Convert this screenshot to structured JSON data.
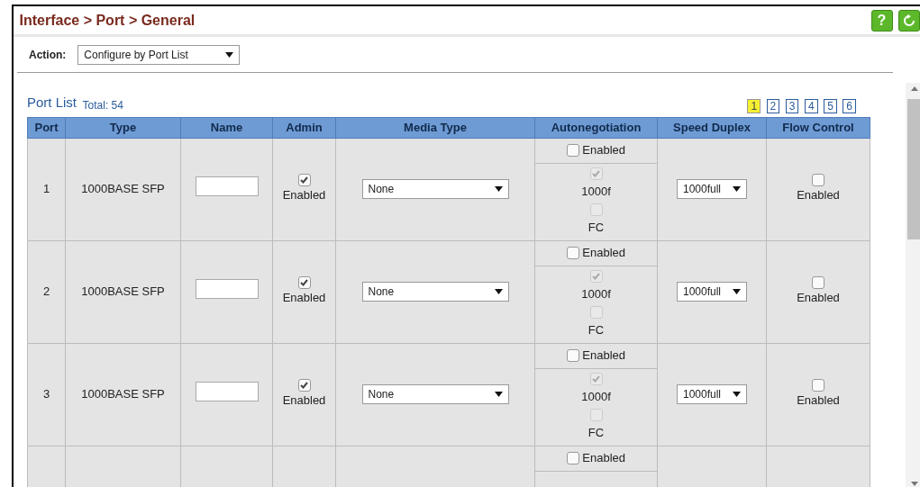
{
  "breadcrumb": "Interface > Port > General",
  "header_buttons": [
    {
      "kind": "help",
      "label": "?"
    },
    {
      "kind": "refresh"
    }
  ],
  "action": {
    "label": "Action:",
    "value": "Configure by Port List"
  },
  "port_list": {
    "title": "Port List",
    "total": "Total: 54",
    "pages": [
      {
        "label": "1",
        "selected": true
      },
      {
        "label": "2",
        "selected": false
      },
      {
        "label": "3",
        "selected": false
      },
      {
        "label": "4",
        "selected": false
      },
      {
        "label": "5",
        "selected": false
      },
      {
        "label": "6",
        "selected": false
      }
    ]
  },
  "table": {
    "columns": [
      "Port",
      "Type",
      "Name",
      "Admin",
      "Media Type",
      "Autonegotiation",
      "Speed Duplex",
      "Flow Control"
    ],
    "rows": [
      {
        "port": "1",
        "type": "1000BASE SFP",
        "admin_label": "Enabled",
        "admin_checked": true,
        "media_type": "None",
        "autoneg_label": "Enabled",
        "autoneg_checked": false,
        "capabilities": [
          {
            "label": "1000f",
            "checked": true,
            "disabled": true
          },
          {
            "label": "FC",
            "checked": false,
            "disabled": true
          }
        ],
        "speed_duplex": "1000full",
        "flow_label": "Enabled",
        "flow_checked": false
      },
      {
        "port": "2",
        "type": "1000BASE SFP",
        "admin_label": "Enabled",
        "admin_checked": true,
        "media_type": "None",
        "autoneg_label": "Enabled",
        "autoneg_checked": false,
        "capabilities": [
          {
            "label": "1000f",
            "checked": true,
            "disabled": true
          },
          {
            "label": "FC",
            "checked": false,
            "disabled": true
          }
        ],
        "speed_duplex": "1000full",
        "flow_label": "Enabled",
        "flow_checked": false
      },
      {
        "port": "3",
        "type": "1000BASE SFP",
        "admin_label": "Enabled",
        "admin_checked": true,
        "media_type": "None",
        "autoneg_label": "Enabled",
        "autoneg_checked": false,
        "capabilities": [
          {
            "label": "1000f",
            "checked": true,
            "disabled": true
          },
          {
            "label": "FC",
            "checked": false,
            "disabled": true
          }
        ],
        "speed_duplex": "1000full",
        "flow_label": "Enabled",
        "flow_checked": false
      },
      {
        "autoneg_label": "Enabled",
        "autoneg_checked": false
      }
    ]
  }
}
